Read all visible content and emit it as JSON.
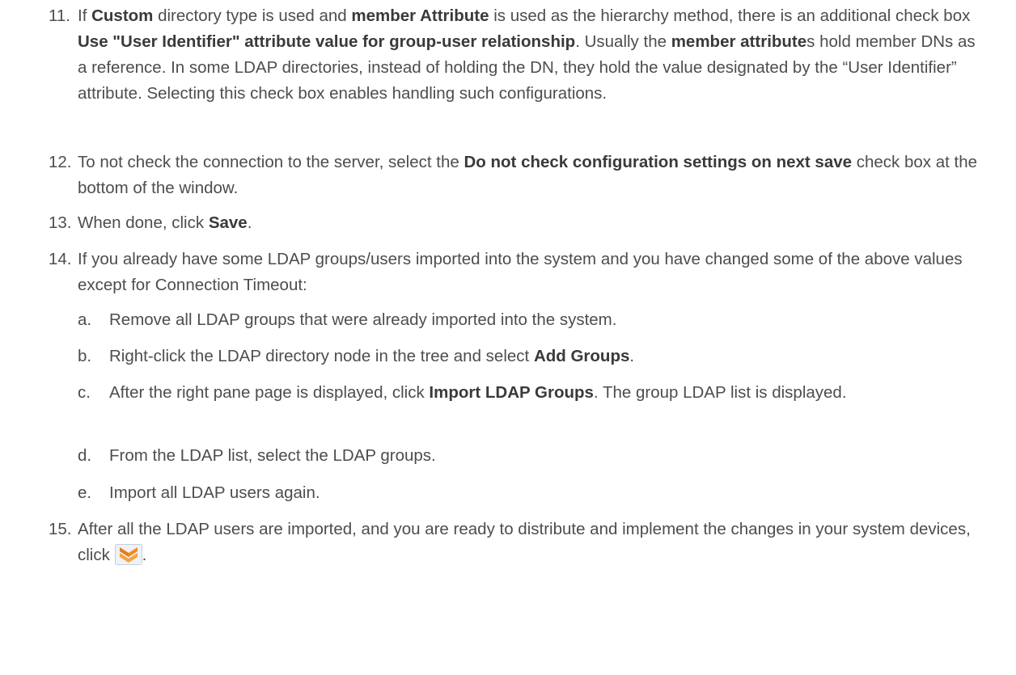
{
  "items": [
    {
      "num": "11.",
      "segments": [
        {
          "t": "If "
        },
        {
          "b": "Custom"
        },
        {
          "t": " directory type is used and "
        },
        {
          "b": "member Attribute"
        },
        {
          "t": " is used as the hierarchy method, there is an additional check box "
        },
        {
          "b": "Use \"User Identifier\" attribute value for group-user relationship"
        },
        {
          "t": ". Usually the "
        },
        {
          "b": "member attribute"
        },
        {
          "t": "s hold member DNs as a reference. In some LDAP directories, instead of holding the DN, they hold the value designated by the “User Identifier” attribute. Selecting this check box enables handling such configurations."
        }
      ]
    },
    {
      "num": "12.",
      "segments": [
        {
          "t": "To not check the connection to the server, select the "
        },
        {
          "b": "Do not check configuration settings on next save"
        },
        {
          "t": " check box at the bottom of the window."
        }
      ]
    },
    {
      "num": "13.",
      "segments": [
        {
          "t": "When done, click "
        },
        {
          "b": "Save"
        },
        {
          "t": "."
        }
      ]
    },
    {
      "num": "14.",
      "segments": [
        {
          "t": "If you already have some LDAP groups/users imported into the system and you have changed some of the above values except for Connection Timeout:"
        }
      ]
    },
    {
      "num": "15.",
      "segments": [
        {
          "t": "After all the LDAP users are imported, and you are ready to distribute and implement the changes in your system devices, click "
        },
        {
          "icon": "deploy-changes-icon"
        },
        {
          "t": "."
        }
      ]
    }
  ],
  "subitems": [
    {
      "letter": "a.",
      "segments": [
        {
          "t": "Remove all LDAP groups that were already imported into the system."
        }
      ]
    },
    {
      "letter": "b.",
      "segments": [
        {
          "t": "Right-click the LDAP directory node in the tree and select "
        },
        {
          "b": "Add Groups"
        },
        {
          "t": "."
        }
      ]
    },
    {
      "letter": "c.",
      "segments": [
        {
          "t": "After the right pane page is displayed, click "
        },
        {
          "b": "Import LDAP Groups"
        },
        {
          "t": ". The group LDAP list is displayed."
        }
      ]
    },
    {
      "letter": "d.",
      "segments": [
        {
          "t": "From the LDAP list, select the LDAP groups."
        }
      ]
    },
    {
      "letter": "e.",
      "segments": [
        {
          "t": "Import all LDAP users again."
        }
      ]
    }
  ]
}
